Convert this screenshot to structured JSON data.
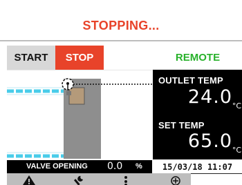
{
  "header": {
    "status_title": "STOPPING..."
  },
  "controls": {
    "start_label": "START",
    "stop_label": "STOP",
    "remote_label": "REMOTE"
  },
  "colors": {
    "accent_red": "#e8432a",
    "remote_green": "#27b12a",
    "panel_bg": "#000000",
    "flow_blue": "#36c7e8"
  },
  "readouts": {
    "outlet_temp_label": "OUTLET TEMP",
    "outlet_temp_value": "24.0",
    "outlet_temp_unit": "°C",
    "set_temp_label": "SET TEMP",
    "set_temp_value": "65.0",
    "set_temp_unit": "°C"
  },
  "valve": {
    "label": "VALVE OPENING",
    "value": "0.0",
    "unit": "%"
  },
  "datetime": "15/03/18 11:07",
  "bottom_icons": [
    "warning-icon",
    "wrench-icon",
    "more-vertical-icon",
    "plus-circle-icon"
  ]
}
